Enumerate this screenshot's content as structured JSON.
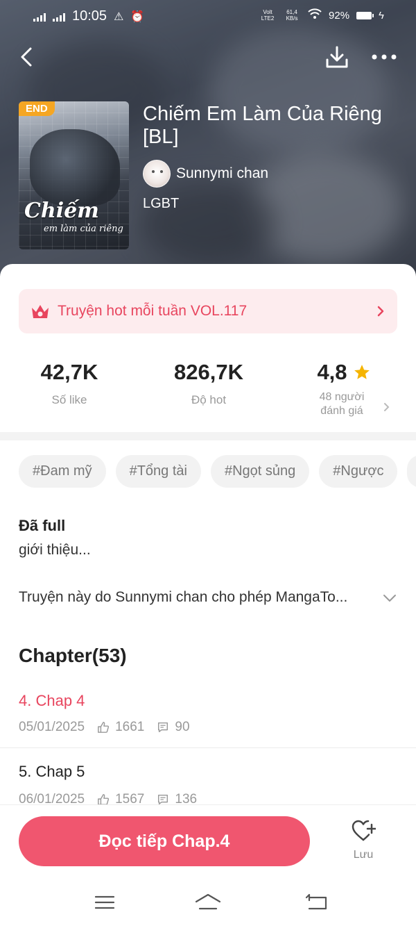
{
  "status_bar": {
    "time": "10:05",
    "network": "Volt LTE2",
    "speed": "61,4 KB/s",
    "battery": "92%"
  },
  "book": {
    "title": "Chiếm Em Làm Của Riêng [BL]",
    "badge": "END",
    "cover_title_line1": "Chiếm",
    "cover_title_line2": "em làm của riêng",
    "author": "Sunnymi chan",
    "genre": "LGBT"
  },
  "hot_banner": {
    "text": "Truyện hot mỗi tuần VOL.117",
    "accent": "#e8455e"
  },
  "stats": {
    "likes_value": "42,7K",
    "likes_label": "Số like",
    "hot_value": "826,7K",
    "hot_label": "Độ hot",
    "rating_value": "4,8",
    "rating_label_line1": "48 người",
    "rating_label_line2": "đánh giá"
  },
  "tags": [
    "#Đam mỹ",
    "#Tổng tài",
    "#Ngọt sủng",
    "#Ngược"
  ],
  "info": {
    "status": "Đã full",
    "intro_label": "giới thiệu...",
    "description": "Truyện này do Sunnymi chan cho phép MangaTo..."
  },
  "chapters": {
    "heading": "Chapter(53)",
    "items": [
      {
        "title": "4. Chap 4",
        "date": "05/01/2025",
        "likes": "1661",
        "comments": "90"
      },
      {
        "title": "5. Chap 5",
        "date": "06/01/2025",
        "likes": "1567",
        "comments": "136"
      }
    ]
  },
  "actions": {
    "read_button": "Đọc tiếp Chap.4",
    "save_label": "Lưu",
    "primary_color": "#f0566f"
  },
  "icons": {
    "back": "chevron-left-icon",
    "download": "download-icon",
    "more": "more-horizontal-icon",
    "crown": "crown-icon",
    "star": "star-icon",
    "like": "thumb-up-icon",
    "comment": "comment-icon",
    "save": "heart-plus-icon"
  }
}
